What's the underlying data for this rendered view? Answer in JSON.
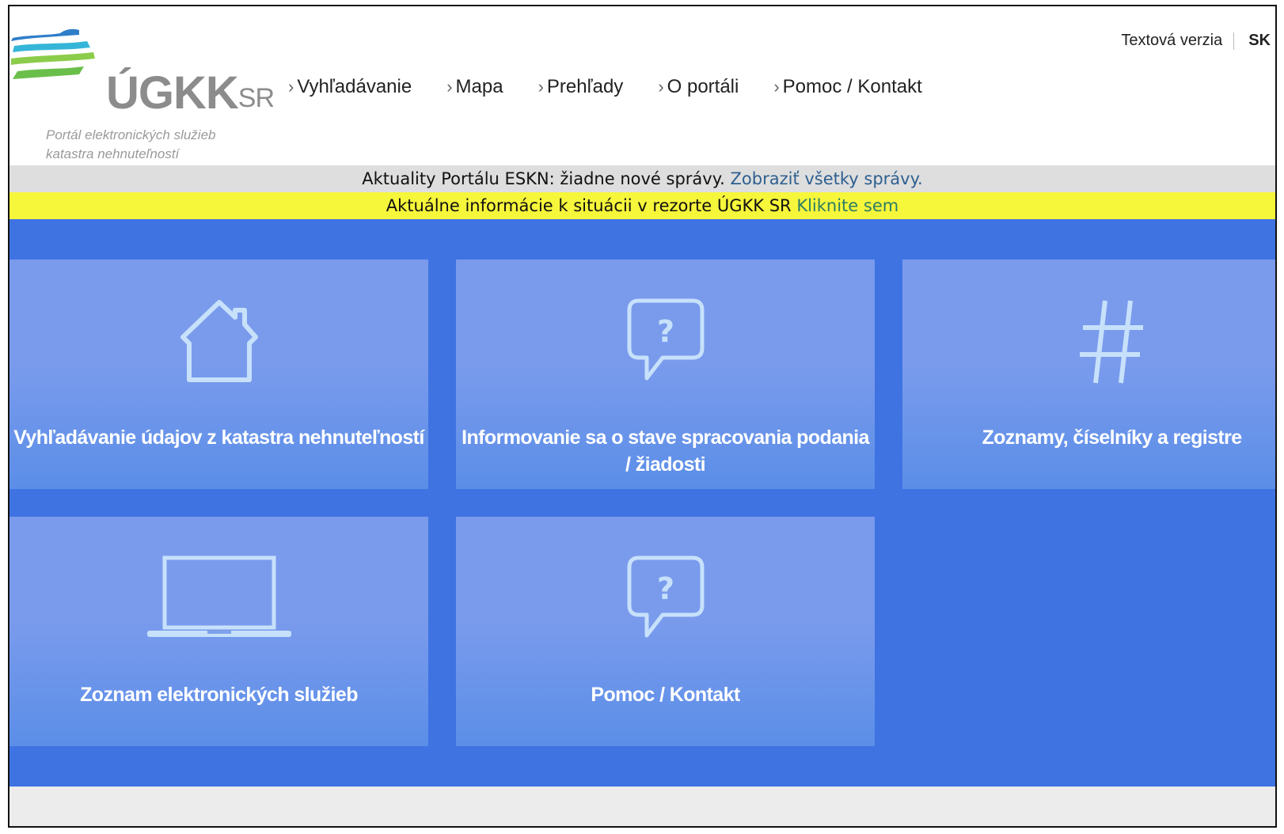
{
  "header": {
    "logo_text": "ÚGKK",
    "logo_suffix": "SR",
    "tagline_line1": "Portál elektronických služieb",
    "tagline_line2": "katastra nehnuteľností",
    "text_version": "Textová verzia",
    "language": "SK"
  },
  "nav": {
    "items": [
      {
        "label": "Vyhľadávanie"
      },
      {
        "label": "Mapa"
      },
      {
        "label": "Prehľady"
      },
      {
        "label": "O portáli"
      },
      {
        "label": "Pomoc / Kontakt"
      }
    ]
  },
  "news": {
    "text": "Aktuality Portálu ESKN: žiadne nové správy.",
    "link": "Zobraziť všetky správy."
  },
  "alert": {
    "text": "Aktuálne informácie k situácii v rezorte ÚGKK SR",
    "link": "Kliknite sem"
  },
  "tiles": [
    {
      "label": "Vyhľadávanie údajov z katastra nehnuteľností",
      "icon": "house-icon"
    },
    {
      "label": "Informovanie sa o stave spracovania podania / žiadosti",
      "icon": "question-bubble-icon"
    },
    {
      "label": "Zoznamy, číselníky a registre",
      "icon": "hash-icon"
    },
    {
      "label": "Zoznam elektronických služieb",
      "icon": "laptop-icon"
    },
    {
      "label": "Pomoc / Kontakt",
      "icon": "question-bubble-icon"
    }
  ],
  "colors": {
    "tiles_background": "#3f73e2",
    "tile": "#7a9bec",
    "alert_bar": "#f6f63b",
    "news_bar": "#dedede"
  }
}
